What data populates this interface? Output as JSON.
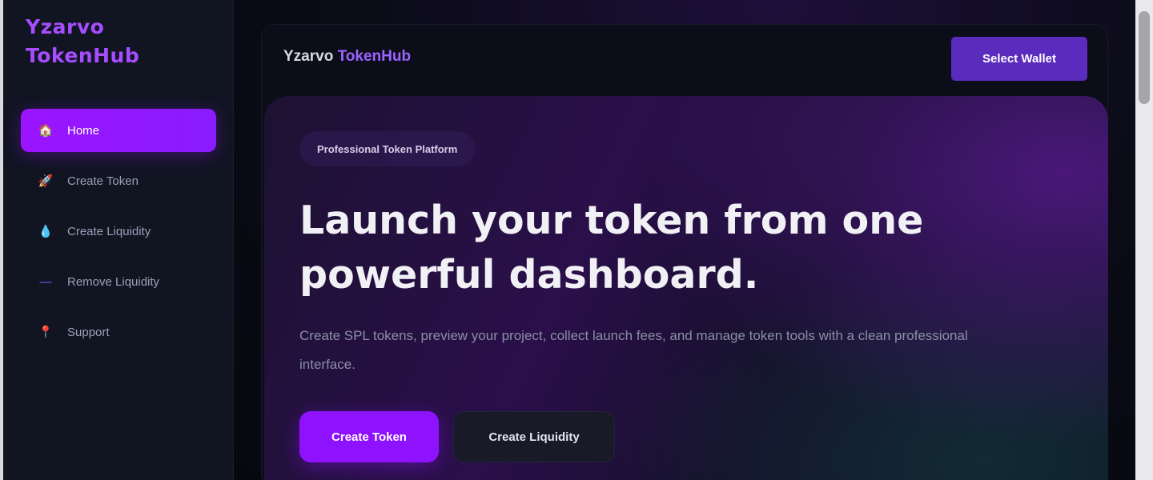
{
  "brand": {
    "name": "Yzarvo TokenHub"
  },
  "sidebar": {
    "items": [
      {
        "label": "Home",
        "icon": "house-icon",
        "glyph": "🏠"
      },
      {
        "label": "Create Token",
        "icon": "rocket-icon",
        "glyph": "🚀"
      },
      {
        "label": "Create Liquidity",
        "icon": "droplet-icon",
        "glyph": "💧"
      },
      {
        "label": "Remove Liquidity",
        "icon": "minus-icon",
        "glyph": "—"
      },
      {
        "label": "Support",
        "icon": "pin-icon",
        "glyph": "📍"
      }
    ]
  },
  "topbar": {
    "title_main": "Yzarvo",
    "title_accent": "TokenHub",
    "wallet_label": "Select Wallet"
  },
  "hero": {
    "badge": "Professional Token Platform",
    "headline_line1": "Launch your token from one",
    "headline_line2": "powerful dashboard.",
    "subtitle": "Create SPL tokens, preview your project, collect launch fees, and manage token tools with a clean professional interface.",
    "primary_cta": "Create Token",
    "secondary_cta": "Create Liquidity"
  },
  "colors": {
    "accent": "#9a14ff",
    "brand_text": "#a64dff",
    "wallet_button": "#5a2bbd",
    "sidebar_bg": "#111421",
    "background": "#0a0b14"
  }
}
